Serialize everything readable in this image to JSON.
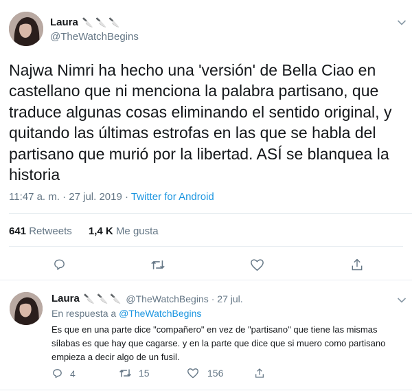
{
  "main_tweet": {
    "author_name": "Laura",
    "author_emojis": "🔪🔪🔪",
    "author_handle": "@TheWatchBegins",
    "text": "Najwa Nimri ha hecho una 'versión' de Bella Ciao en castellano que ni menciona la palabra partisano, que traduce algunas cosas eliminando el sentido original, y quitando las últimas estrofas en las que se habla del partisano que murió por la libertad. ASÍ se blanquea la historia",
    "timestamp": "11:47 a. m. · 27 jul. 2019 · ",
    "source": "Twitter for Android",
    "retweets_count": "641",
    "retweets_label": "Retweets",
    "likes_count": "1,4 K",
    "likes_label": "Me gusta",
    "icons": [
      "reply-icon",
      "retweet-icon",
      "like-icon",
      "share-icon",
      "chevron-down-icon"
    ]
  },
  "reply_tweet": {
    "author_name": "Laura",
    "author_emojis": "🔪🔪🔪",
    "author_handle": "@TheWatchBegins",
    "date": "· 27 jul.",
    "reply_prefix": "En respuesta a ",
    "reply_mention": "@TheWatchBegins",
    "text": "Es que en una parte dice \"compañero\" en vez de \"partisano\" que tiene las mismas sílabas es que hay que cagarse. y en la parte que dice que si muero como partisano empieza a decir algo de un fusil.",
    "reply_count": "4",
    "retweet_count": "15",
    "like_count": "156"
  },
  "colors": {
    "text": "#14171a",
    "secondary": "#657786",
    "link": "#1b95e0",
    "border": "#e6ecf0"
  }
}
